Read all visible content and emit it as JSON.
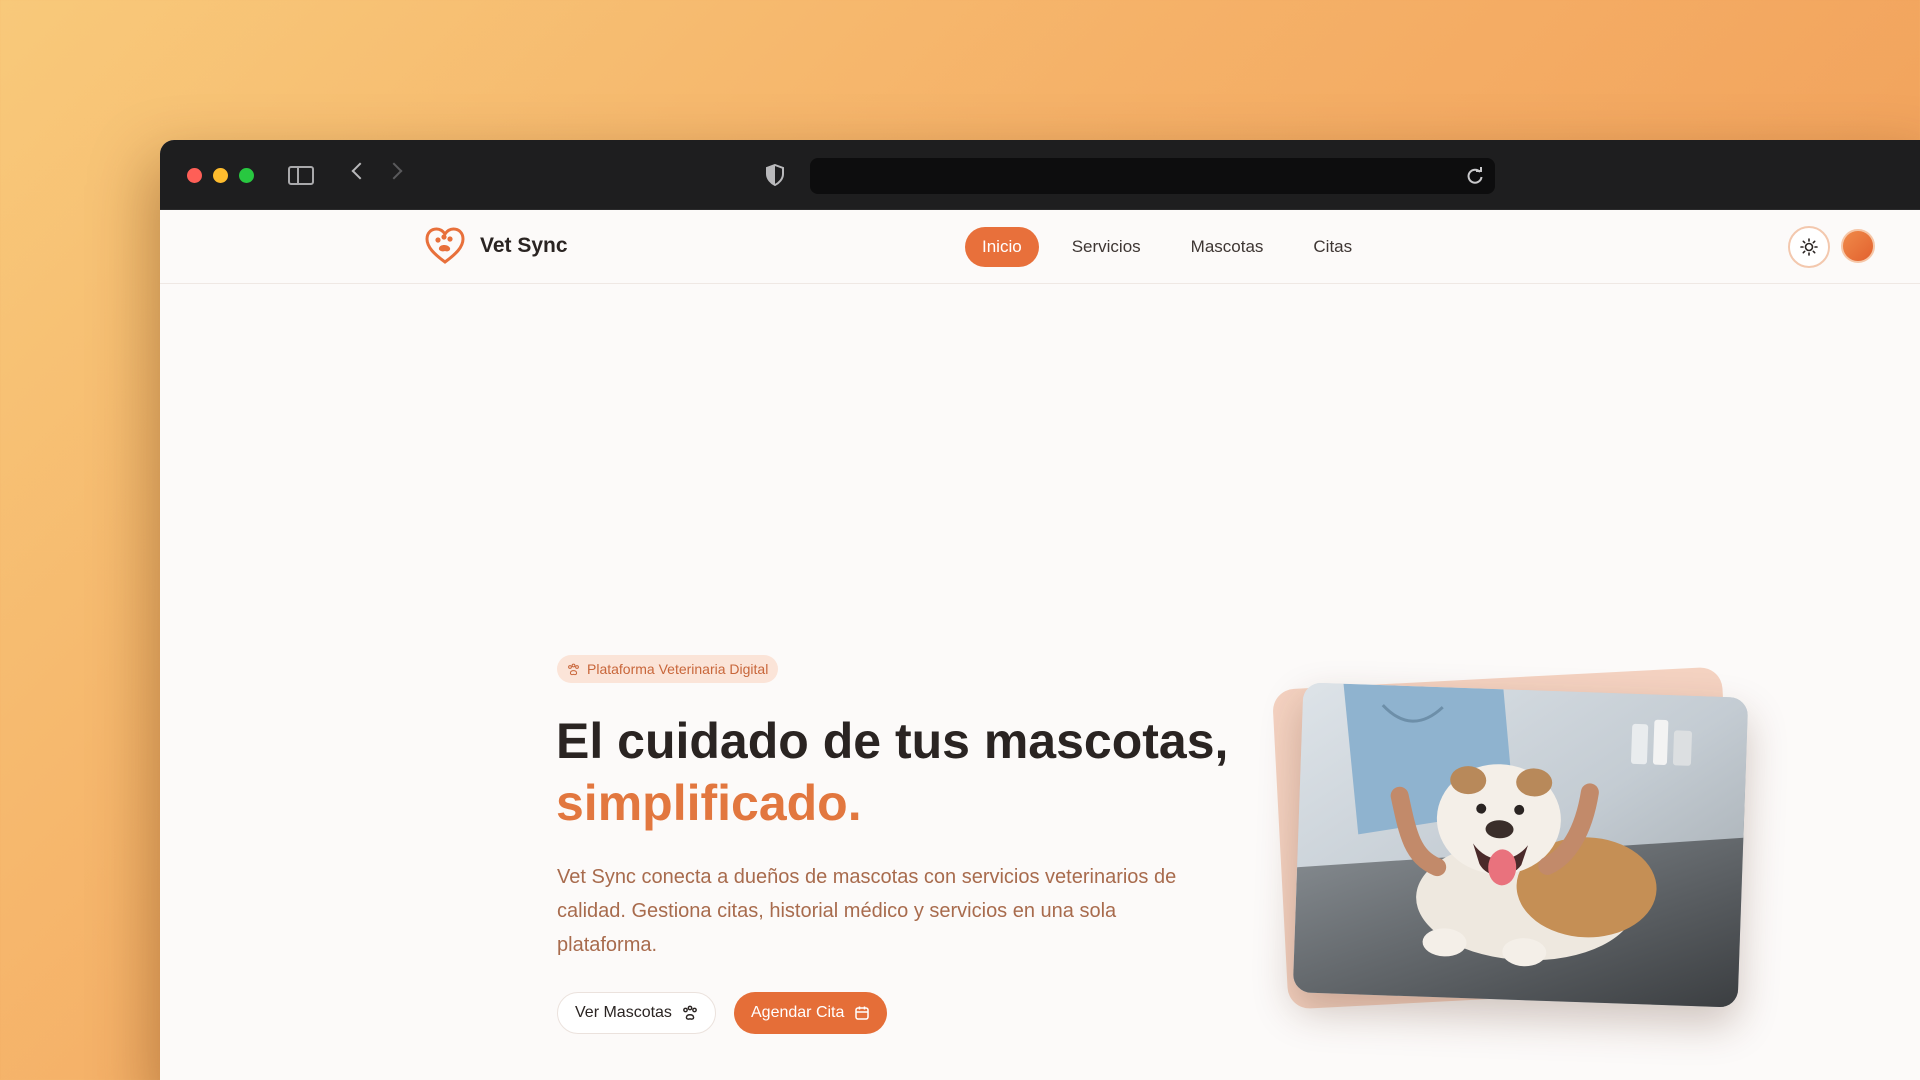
{
  "browser": {
    "url": ""
  },
  "brand": {
    "name": "Vet Sync"
  },
  "nav": {
    "items": [
      {
        "label": "Inicio",
        "active": true
      },
      {
        "label": "Servicios",
        "active": false
      },
      {
        "label": "Mascotas",
        "active": false
      },
      {
        "label": "Citas",
        "active": false
      }
    ]
  },
  "hero": {
    "badge": "Plataforma Veterinaria Digital",
    "headline_main": "El cuidado de tus mascotas,",
    "headline_accent": "simplificado.",
    "description": "Vet Sync conecta a dueños de mascotas con servicios veterinarios de calidad. Gestiona citas, historial médico y servicios en una sola plataforma.",
    "secondary_button": "Ver Mascotas",
    "primary_button": "Agendar Cita"
  },
  "colors": {
    "accent": "#e8703b",
    "text_dark": "#2a2422",
    "text_muted": "#a86b4d"
  },
  "icons": {
    "logo": "heart-paw-icon",
    "theme": "sun-icon",
    "secondary_button": "paw-icon",
    "primary_button": "calendar-icon"
  }
}
